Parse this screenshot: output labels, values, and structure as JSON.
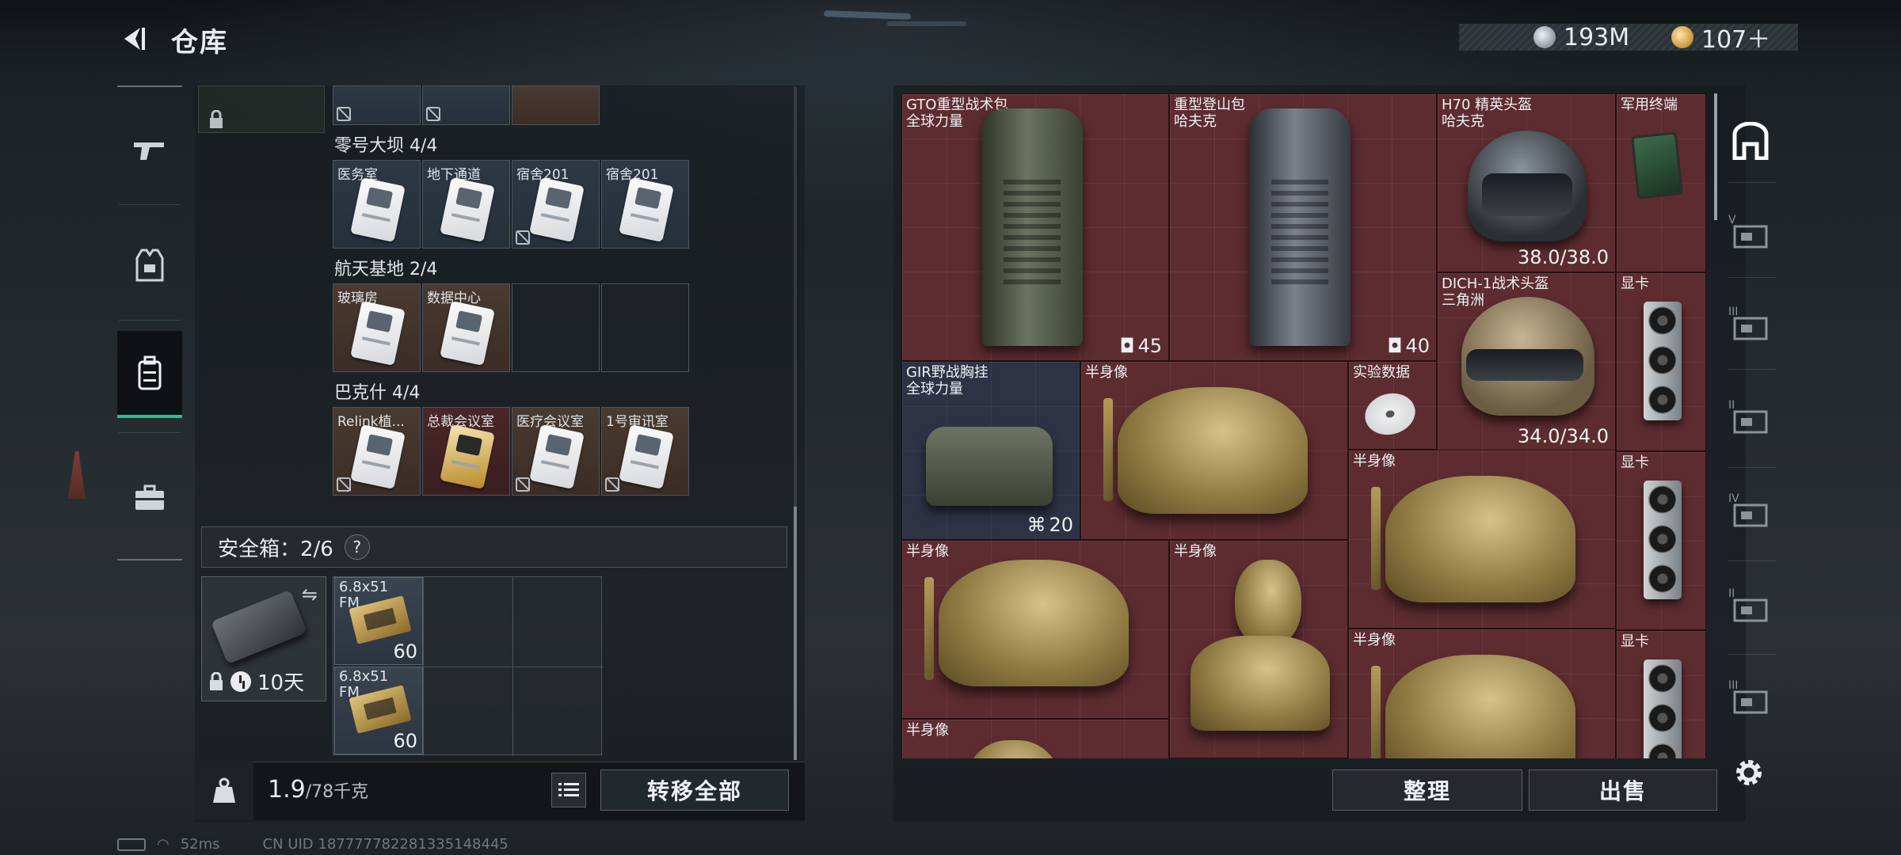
{
  "header": {
    "title": "仓库"
  },
  "currency": {
    "silver": "193M",
    "gold": "107＋"
  },
  "left_panel": {
    "groups": [
      {
        "title": "零号大坝 4/4",
        "items": [
          {
            "name": "医务室",
            "marked": false
          },
          {
            "name": "地下通道",
            "marked": false
          },
          {
            "name": "宿舍201",
            "marked": true
          },
          {
            "name": "宿舍201",
            "marked": false
          }
        ]
      },
      {
        "title": "航天基地 2/4",
        "items": [
          {
            "name": "玻璃房",
            "marked": false
          },
          {
            "name": "数据中心",
            "marked": false
          }
        ]
      },
      {
        "title": "巴克什 4/4",
        "items": [
          {
            "name": "Relink植...",
            "marked": true
          },
          {
            "name": "总裁会议室",
            "marked": false
          },
          {
            "name": "医疗会议室",
            "marked": true
          },
          {
            "name": "1号审讯室",
            "marked": true
          }
        ]
      }
    ],
    "safe_box": {
      "label": "安全箱：2/6",
      "help": "?",
      "time": "10天",
      "ammo": [
        {
          "name": "6.8x51",
          "sub": "FM",
          "qty": "60"
        },
        {
          "name": "6.8x51",
          "sub": "FM",
          "qty": "60"
        }
      ]
    },
    "weight": {
      "current": "1.9",
      "max": "/78千克"
    },
    "transfer_all": "转移全部"
  },
  "right_panel": {
    "items": [
      {
        "name": "GTO重型战术包",
        "sub": "全球力量",
        "qty": "45"
      },
      {
        "name": "重型登山包",
        "sub": "哈夫克",
        "qty": "40"
      },
      {
        "name": "H70 精英头盔",
        "sub": "哈夫克",
        "qty": "38.0/38.0"
      },
      {
        "name": "军用终端",
        "sub": "",
        "qty": ""
      },
      {
        "name": "DICH-1战术头盔",
        "sub": "三角洲",
        "qty": "34.0/34.0"
      },
      {
        "name": "显卡",
        "sub": "",
        "qty": ""
      },
      {
        "name": "GIR野战胸挂",
        "sub": "全球力量",
        "qty": "20"
      },
      {
        "name": "半身像",
        "sub": "",
        "qty": ""
      },
      {
        "name": "实验数据",
        "sub": "",
        "qty": ""
      },
      {
        "name": "半身像",
        "sub": "",
        "qty": ""
      },
      {
        "name": "显卡",
        "sub": "",
        "qty": ""
      },
      {
        "name": "半身像",
        "sub": "",
        "qty": ""
      },
      {
        "name": "半身像",
        "sub": "",
        "qty": ""
      },
      {
        "name": "半身像",
        "sub": "",
        "qty": ""
      },
      {
        "name": "显卡",
        "sub": "",
        "qty": ""
      },
      {
        "name": "半身像",
        "sub": "",
        "qty": ""
      }
    ],
    "sort_btn": "整理",
    "sell_btn": "出售"
  },
  "right_tabs": [
    "V",
    "III",
    "II",
    "IV",
    "II",
    "III"
  ],
  "status_bar": {
    "ping": "52ms",
    "uid": "CN UID 187777782281335148445"
  },
  "colors": {
    "accent": "#25c18c",
    "item_bg": "#5d2c31"
  }
}
